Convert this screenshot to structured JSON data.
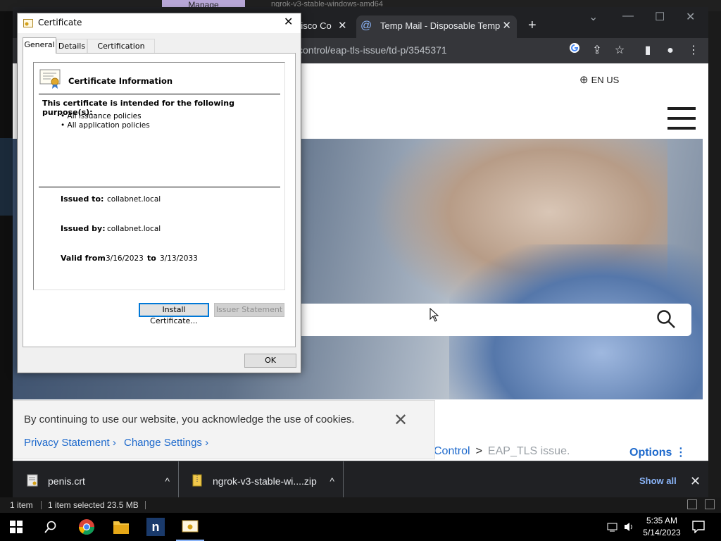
{
  "explorer": {
    "ribbon_tab": "Manage",
    "ribbon_text": "ngrok-v3-stable-windows-amd64",
    "status_items": "1 item",
    "status_selected": "1 item selected  23.5 MB"
  },
  "browser": {
    "tabs": [
      {
        "label": "Cisco Co"
      },
      {
        "label": "Temp Mail - Disposable Temporary Email"
      }
    ],
    "new_tab": "+",
    "window_controls": {
      "chevron": "⌄",
      "minimize": "—",
      "maximize": "☐",
      "close": "✕"
    },
    "url": "control/eap-tls-issue/td-p/3545371",
    "toolbar_icons": [
      "google-icon",
      "share-icon",
      "star-icon",
      "side-panel-icon",
      "profile-icon",
      "menu-icon"
    ]
  },
  "page": {
    "language": "EN US",
    "breadcrumb": {
      "parent": "Control",
      "separator": ">",
      "current": "EAP_TLS issue."
    },
    "options": "Options ⋮"
  },
  "cookie_banner": {
    "text": "By continuing to use our website, you acknowledge the use of cookies.",
    "privacy_link": "Privacy Statement ›",
    "settings_link": "Change Settings ›",
    "close": "✕"
  },
  "downloads": {
    "items": [
      {
        "name": "penis.crt",
        "caret": "^"
      },
      {
        "name": "ngrok-v3-stable-wi....zip",
        "caret": "^"
      }
    ],
    "show_all": "Show all",
    "close": "✕"
  },
  "certificate_dialog": {
    "title": "Certificate",
    "close": "✕",
    "tabs": [
      "General",
      "Details",
      "Certification Path"
    ],
    "active_tab": "General",
    "info_heading": "Certificate Information",
    "purpose_title": "This certificate is intended for the following purpose(s):",
    "purposes": [
      "• All issuance policies",
      "• All application policies"
    ],
    "issued_to_label": "Issued to:",
    "issued_to": "collabnet.local",
    "issued_by_label": "Issued by:",
    "issued_by": "collabnet.local",
    "valid_from_label": "Valid from",
    "valid_from": "3/16/2023",
    "valid_to_label": "to",
    "valid_to": "3/13/2033",
    "install_button": "Install Certificate...",
    "issuer_button": "Issuer Statement",
    "ok_button": "OK"
  },
  "taskbar": {
    "time": "5:35 AM",
    "date": "5/14/2023",
    "apps": [
      "start-icon",
      "search-icon",
      "chrome-icon",
      "file-explorer-icon",
      "notion-icon",
      "certificate-icon"
    ]
  },
  "colors": {
    "accent": "#0078d7",
    "link": "#1d69cc",
    "taskbar": "#000000"
  }
}
